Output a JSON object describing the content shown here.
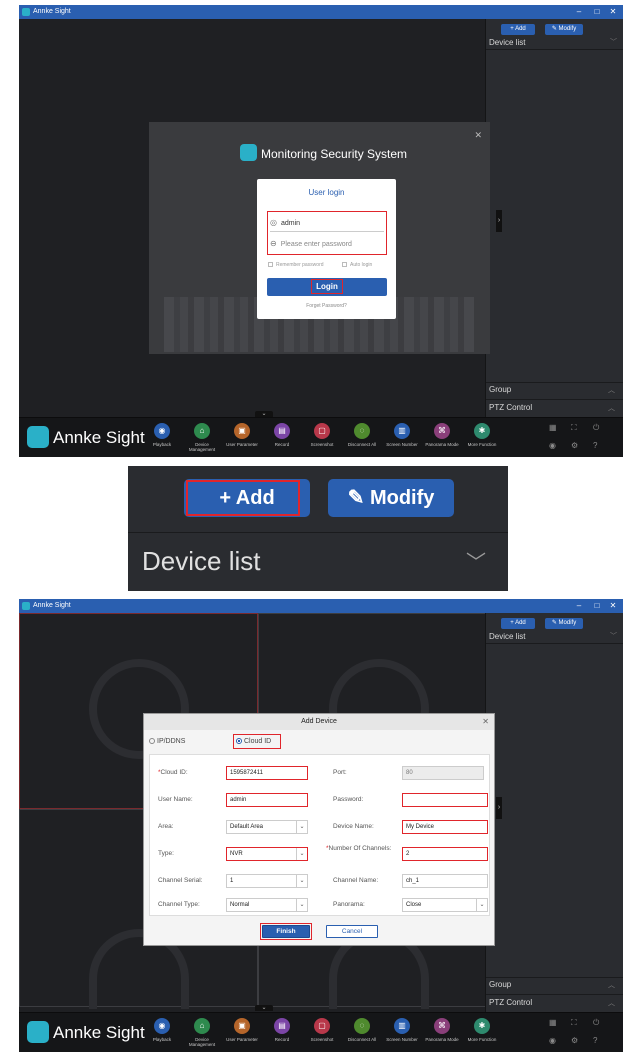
{
  "app": {
    "title": "Annke Sight",
    "brand": "Annke Sight",
    "window_controls": [
      "–",
      "□",
      "✕"
    ]
  },
  "sidebar": {
    "add_label": "+ Add",
    "modify_label": "Modify",
    "device_list_label": "Device list",
    "group_label": "Group",
    "ptz_label": "PTZ Control"
  },
  "toolbar": {
    "items": [
      {
        "label": "Playback",
        "icon": "playback-icon",
        "color": "#2a5fb0"
      },
      {
        "label": "Device Management",
        "icon": "device-management-icon",
        "color": "#2e8a4e"
      },
      {
        "label": "User Parameter",
        "icon": "user-parameter-icon",
        "color": "#b5652a"
      },
      {
        "label": "Record",
        "icon": "record-icon",
        "color": "#7b45a6"
      },
      {
        "label": "Screenshot",
        "icon": "screenshot-icon",
        "color": "#b8384a"
      },
      {
        "label": "Disconnect All",
        "icon": "disconnect-all-icon",
        "color": "#4f8a2e"
      },
      {
        "label": "Screen Number",
        "icon": "screen-number-icon",
        "color": "#2a5fb0"
      },
      {
        "label": "Panorama Mode",
        "icon": "panorama-mode-icon",
        "color": "#8a3f7a"
      },
      {
        "label": "More Function",
        "icon": "more-function-icon",
        "color": "#2e8a6e"
      }
    ]
  },
  "login": {
    "heading": "Monitoring Security System",
    "card_title": "User login",
    "username_value": "admin",
    "password_placeholder": "Please enter password",
    "remember_label": "Remember password",
    "auto_login_label": "Auto login",
    "login_button": "Login",
    "forget_link": "Forget Password?"
  },
  "zoom": {
    "add_label": "+  Add",
    "modify_label": "Modify",
    "device_list_label": "Device list"
  },
  "add_device": {
    "title": "Add Device",
    "radio_ip": "IP/DDNS",
    "radio_cloud": "Cloud ID",
    "cloud_id_label": "Cloud ID:",
    "cloud_id_value": "1595872411",
    "port_label": "Port:",
    "port_value": "80",
    "user_name_label": "User Name:",
    "user_name_value": "admin",
    "password_label": "Password:",
    "password_value": "",
    "area_label": "Area:",
    "area_value": "Default Area",
    "device_name_label": "Device Name:",
    "device_name_value": "My Device",
    "type_label": "Type:",
    "type_value": "NVR",
    "channels_label": "Number Of Channels:",
    "channels_value": "2",
    "serial_label": "Channel Serial:",
    "serial_value": "1",
    "channel_name_label": "Channel Name:",
    "channel_name_value": "ch_1",
    "channel_type_label": "Channel Type:",
    "channel_type_value": "Normal",
    "panorama_label": "Panorama:",
    "panorama_value": "Close",
    "finish_button": "Finish",
    "cancel_button": "Cancel"
  },
  "colors": {
    "accent": "#2a5fb0",
    "highlight": "#e0252b",
    "window_bg": "#1f2023",
    "brand_logo": "#2ab0c8"
  }
}
